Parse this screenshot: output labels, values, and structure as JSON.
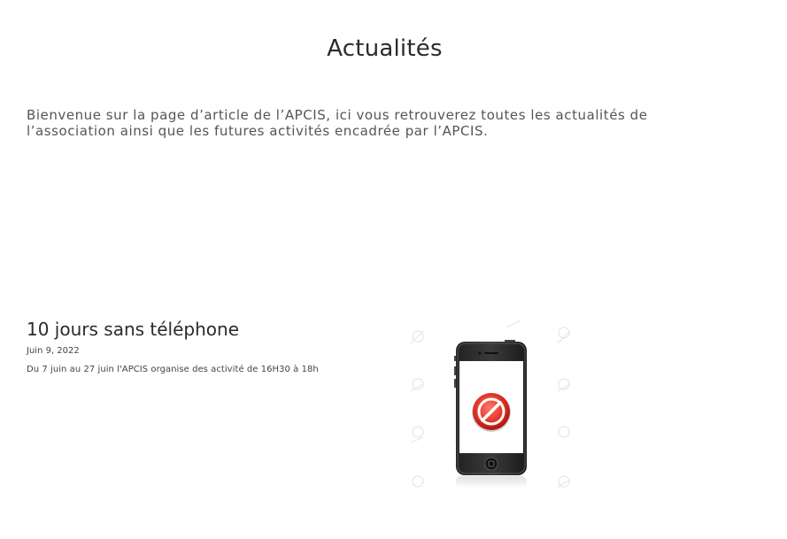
{
  "page": {
    "title": "Actualités",
    "intro": "Bienvenue sur la page d’article de l’APCIS, ici vous retrouverez toutes les actualités de l’association ainsi que les futures activités encadrée par l’APCIS."
  },
  "posts": [
    {
      "title": "10 jours sans téléphone",
      "date": "Juin 9, 2022",
      "excerpt": "Du 7 juin au 27 juin l'APCIS organise des activité de 16H30 à 18h",
      "image_icon": "no-phone-icon"
    }
  ]
}
